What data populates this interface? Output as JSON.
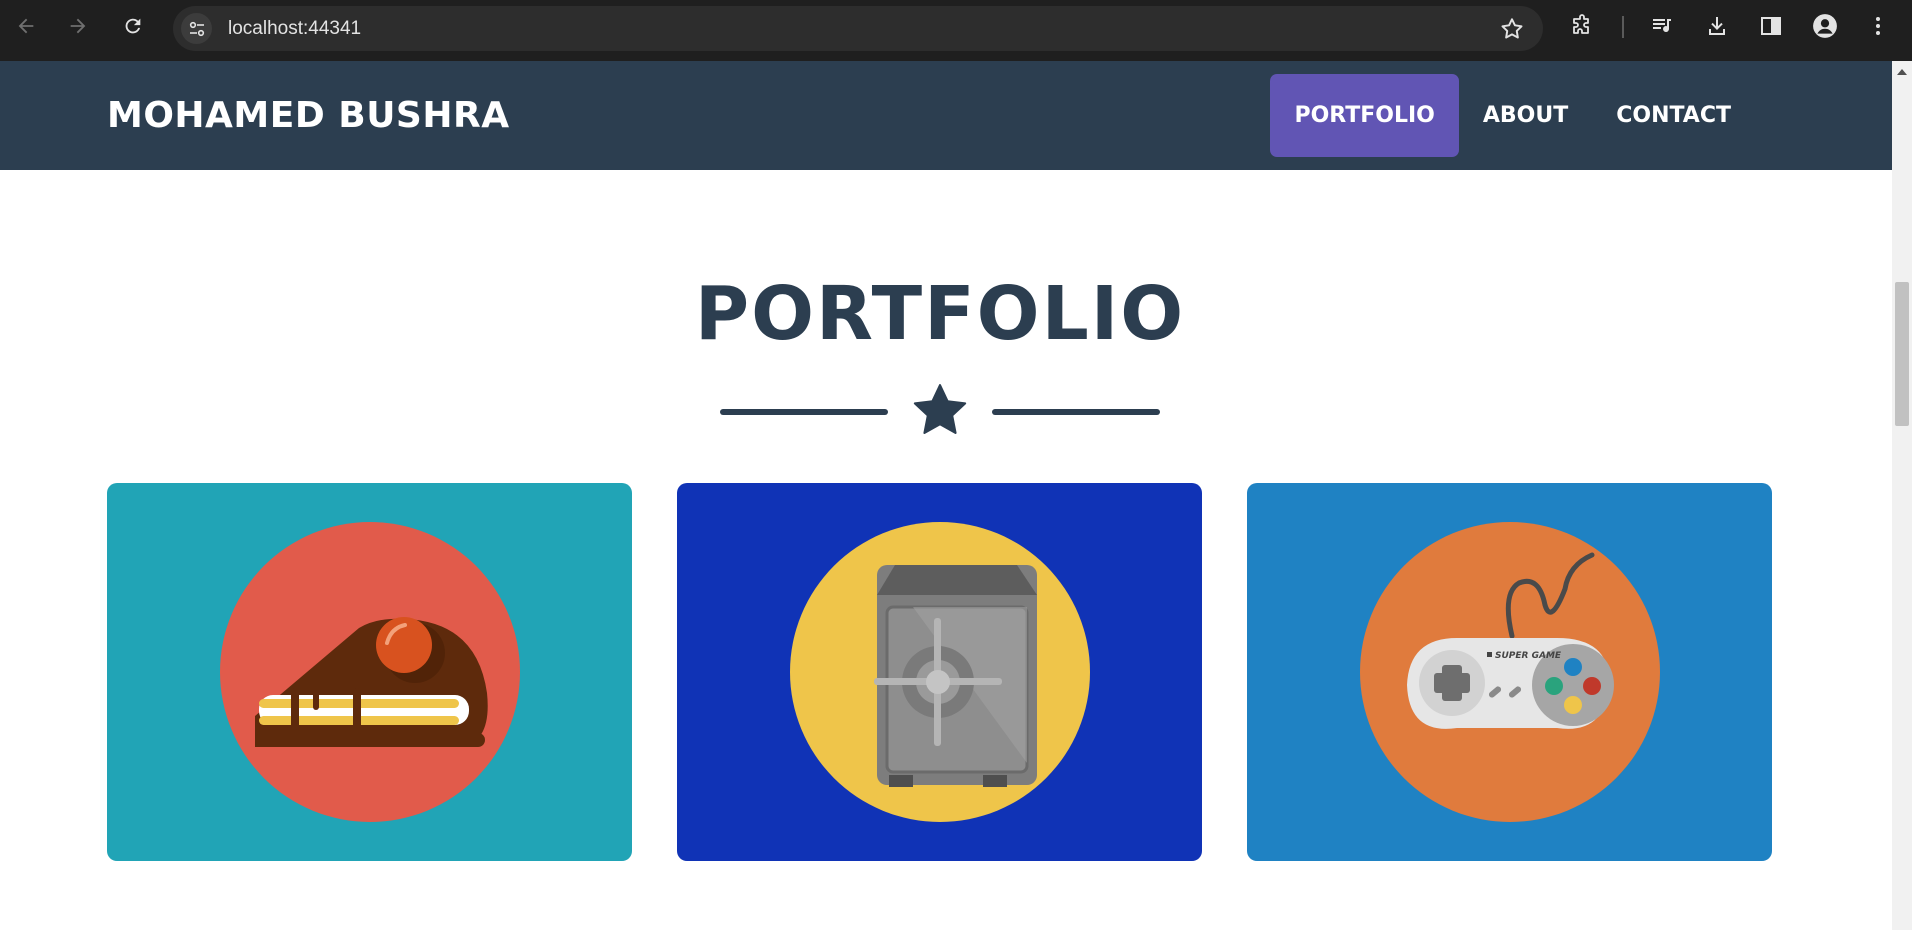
{
  "browser": {
    "url": "localhost:44341",
    "icons": [
      "back-icon",
      "forward-icon",
      "reload-icon",
      "site-info-icon",
      "bookmark-star-icon",
      "extensions-icon",
      "media-controls-icon",
      "download-icon",
      "side-panel-icon",
      "profile-icon",
      "menu-icon"
    ]
  },
  "navbar": {
    "brand": "MOHAMED BUSHRA",
    "items": [
      {
        "label": "PORTFOLIO",
        "active": true
      },
      {
        "label": "ABOUT",
        "active": false
      },
      {
        "label": "CONTACT",
        "active": false
      }
    ]
  },
  "portfolio": {
    "title": "PORTFOLIO",
    "divider_icon": "star-icon",
    "cards": [
      {
        "icon": "cake-icon",
        "background": "#21a4b6",
        "circle": "#e15b4b"
      },
      {
        "icon": "safe-icon",
        "background": "#1033b6",
        "circle": "#efc54a"
      },
      {
        "icon": "game-controller-icon",
        "background": "#1f82c3",
        "circle": "#e07b3d",
        "controller_text": "SUPER GAME"
      }
    ]
  },
  "colors": {
    "navbar": "#2c3e50",
    "active_nav": "#6155b4",
    "title": "#2c3e50"
  }
}
